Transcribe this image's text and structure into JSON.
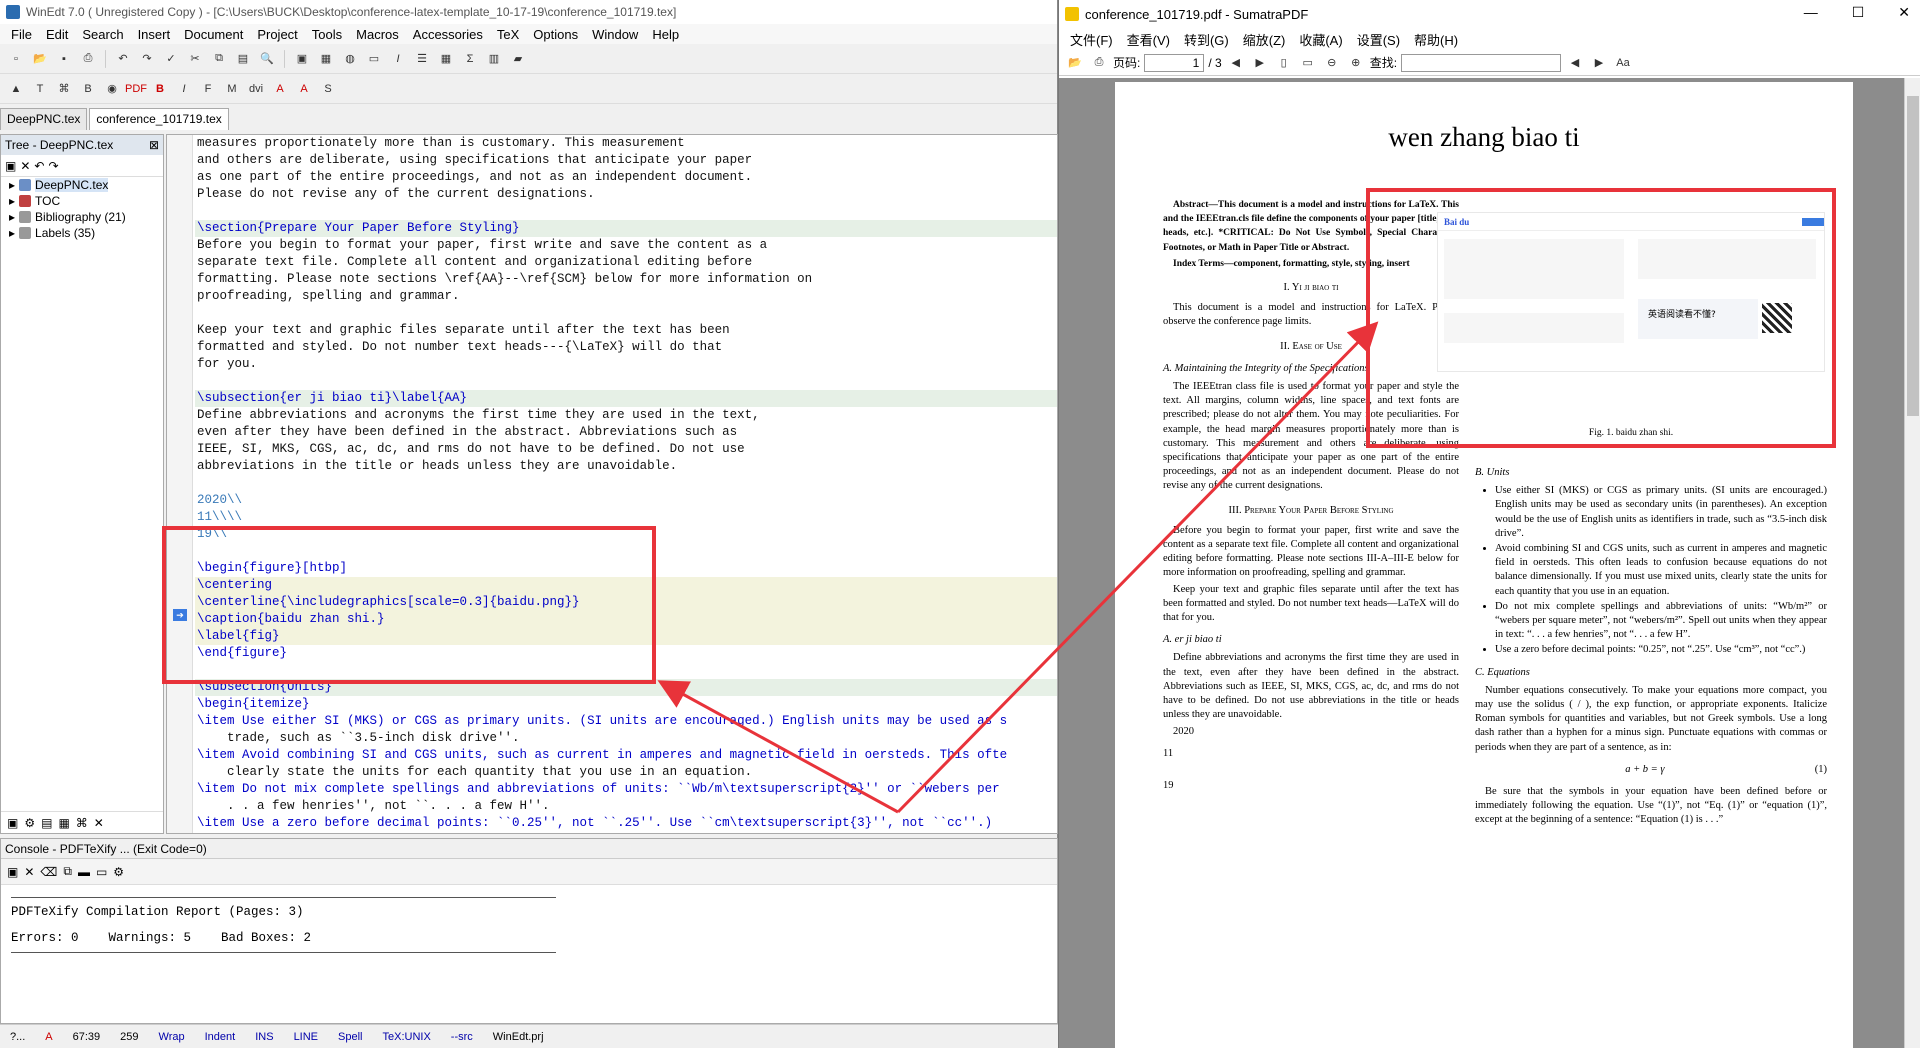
{
  "winedt": {
    "title": "WinEdt 7.0  ( Unregistered  Copy )  - [C:\\Users\\BUCK\\Desktop\\conference-latex-template_10-17-19\\conference_101719.tex]",
    "menu": [
      "File",
      "Edit",
      "Search",
      "Insert",
      "Document",
      "Project",
      "Tools",
      "Macros",
      "Accessories",
      "TeX",
      "Options",
      "Window",
      "Help"
    ],
    "tabs": [
      "DeepPNC.tex",
      "conference_101719.tex"
    ],
    "tree": {
      "title": "Tree - DeepPNC.tex",
      "items": [
        "DeepPNC.tex",
        "TOC",
        "Bibliography  (21)",
        "Labels  (35)"
      ]
    },
    "code_lines": [
      "measures proportionately more than is customary. This measurement",
      "and others are deliberate, using specifications that anticipate your paper",
      "as one part of the entire proceedings, and not as an independent document.",
      "Please do not revise any of the current designations.",
      "",
      "\\section{Prepare Your Paper Before Styling}",
      "Before you begin to format your paper, first write and save the content as a",
      "separate text file. Complete all content and organizational editing before",
      "formatting. Please note sections \\ref{AA}--\\ref{SCM} below for more information on",
      "proofreading, spelling and grammar.",
      "",
      "Keep your text and graphic files separate until after the text has been",
      "formatted and styled. Do not number text heads---{\\LaTeX} will do that",
      "for you.",
      "",
      "\\subsection{er ji biao ti}\\label{AA}",
      "Define abbreviations and acronyms the first time they are used in the text,",
      "even after they have been defined in the abstract. Abbreviations such as",
      "IEEE, SI, MKS, CGS, ac, dc, and rms do not have to be defined. Do not use",
      "abbreviations in the title or heads unless they are unavoidable.",
      "",
      "2020\\\\",
      "11\\\\\\\\",
      "19\\\\",
      "",
      "\\begin{figure}[htbp]",
      "\\centering",
      "\\centerline{\\includegraphics[scale=0.3]{baidu.png}}",
      "\\caption{baidu zhan shi.}",
      "\\label{fig}",
      "\\end{figure}",
      "",
      "\\subsection{Units}",
      "\\begin{itemize}",
      "\\item Use either SI (MKS) or CGS as primary units. (SI units are encouraged.) English units may be used as s",
      "    trade, such as ``3.5-inch disk drive''.",
      "\\item Avoid combining SI and CGS units, such as current in amperes and magnetic field in oersteds. This ofte",
      "    clearly state the units for each quantity that you use in an equation.",
      "\\item Do not mix complete spellings and abbreviations of units: ``Wb/m\\textsuperscript{2}'' or ``webers per",
      "    . . a few henries'', not ``. . . a few H''.",
      "\\item Use a zero before decimal points: ``0.25'', not ``.25''. Use ``cm\\textsuperscript{3}'', not ``cc''.)"
    ],
    "console": {
      "title": "Console - PDFTeXify ... (Exit Code=0)",
      "report": "PDFTeXify Compilation Report (Pages: 3)",
      "stats": "Errors: 0    Warnings: 5    Bad Boxes: 2"
    },
    "status": [
      "?...",
      "A",
      "67:39",
      "259",
      "Wrap",
      "Indent",
      "INS",
      "LINE",
      "Spell",
      "TeX:UNIX",
      "--src",
      "WinEdt.prj"
    ]
  },
  "sumatra": {
    "title": "conference_101719.pdf - SumatraPDF",
    "menu": [
      "文件(F)",
      "查看(V)",
      "转到(G)",
      "缩放(Z)",
      "收藏(A)",
      "设置(S)",
      "帮助(H)"
    ],
    "page_label": "页码:",
    "page_value": "1",
    "page_total": "/ 3",
    "find_label": "查找:",
    "doc": {
      "title": "wen zhang biao ti",
      "abstract": "Abstract—This document is a model and instructions for LaTeX. This and the IEEEtran.cls file define the components of your paper [title, text, heads, etc.]. *CRITICAL: Do Not Use Symbols, Special Characters, Footnotes, or Math in Paper Title or Abstract.",
      "index_terms": "Index Terms—component, formatting, style, styling, insert",
      "sec1": "I.  Yi ji biao ti",
      "sec1_text": "This document is a model and instructions for LaTeX. Please observe the conference page limits.",
      "sec2": "II.  Ease of Use",
      "sec2a": "A.  Maintaining the Integrity of the Specifications",
      "sec2a_text": "The IEEEtran class file is used to format your paper and style the text. All margins, column widths, line spaces, and text fonts are prescribed; please do not alter them. You may note peculiarities. For example, the head margin measures proportionately more than is customary. This measurement and others are deliberate, using specifications that anticipate your paper as one part of the entire proceedings, and not as an independent document. Please do not revise any of the current designations.",
      "sec3": "III.  Prepare Your Paper Before Styling",
      "sec3_p1": "Before you begin to format your paper, first write and save the content as a separate text file. Complete all content and organizational editing before formatting. Please note sections III-A–III-E below for more information on proofreading, spelling and grammar.",
      "sec3_p2": "Keep your text and graphic files separate until after the text has been formatted and styled. Do not number text heads—LaTeX will do that for you.",
      "sec3a": "A.  er ji biao ti",
      "sec3a_text": "Define abbreviations and acronyms the first time they are used in the text, even after they have been defined in the abstract. Abbreviations such as IEEE, SI, MKS, CGS, ac, dc, and rms do not have to be defined. Do not use abbreviations in the title or heads unless they are unavoidable.",
      "n2020": "2020",
      "n11": "11",
      "n19": "19",
      "fig_caption": "Fig. 1.  baidu zhan shi.",
      "fig_popup": "英语阅读看不懂?",
      "units_head": "B.  Units",
      "units": [
        "Use either SI (MKS) or CGS as primary units. (SI units are encouraged.) English units may be used as secondary units (in parentheses). An exception would be the use of English units as identifiers in trade, such as “3.5-inch disk drive”.",
        "Avoid combining SI and CGS units, such as current in amperes and magnetic field in oersteds. This often leads to confusion because equations do not balance dimensionally. If you must use mixed units, clearly state the units for each quantity that you use in an equation.",
        "Do not mix complete spellings and abbreviations of units: “Wb/m²” or “webers per square meter”, not “webers/m²”. Spell out units when they appear in text: “. . . a few henries”, not “. . . a few H”.",
        "Use a zero before decimal points: “0.25”, not “.25”. Use “cm³”, not “cc”.)"
      ],
      "eq_head": "C.  Equations",
      "eq_p1": "Number equations consecutively. To make your equations more compact, you may use the solidus ( / ), the exp function, or appropriate exponents. Italicize Roman symbols for quantities and variables, but not Greek symbols. Use a long dash rather than a hyphen for a minus sign. Punctuate equations with commas or periods when they are part of a sentence, as in:",
      "eq": "a + b = γ",
      "eq_num": "(1)",
      "eq_p2": "Be sure that the symbols in your equation have been defined before or immediately following the equation. Use “(1)”, not “Eq. (1)” or “equation (1)”, except at the beginning of a sentence: “Equation (1) is . . .”"
    }
  },
  "colors": {
    "annotation_red": "#e8333a",
    "keyword_blue": "#0000c8",
    "arg_green": "#008000"
  }
}
